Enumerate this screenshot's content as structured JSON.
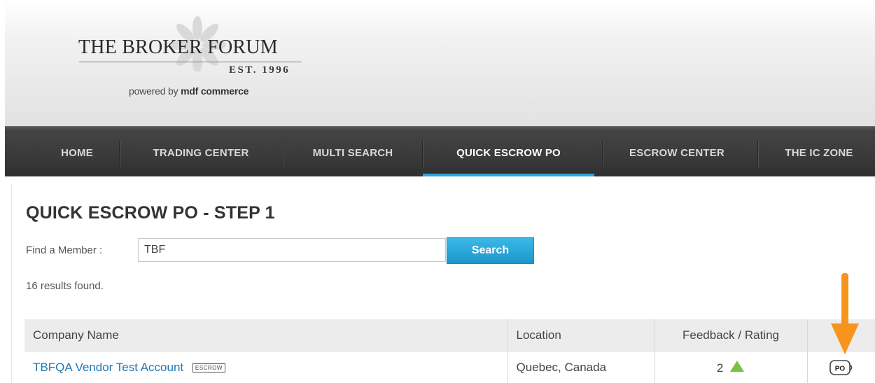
{
  "logo": {
    "title": "THE BROKER FORUM",
    "est": "EST. 1996",
    "powered_prefix": "powered by ",
    "powered_brand": "mdf commerce"
  },
  "nav": {
    "items": [
      {
        "label": "HOME",
        "active": false
      },
      {
        "label": "TRADING CENTER",
        "active": false
      },
      {
        "label": "MULTI SEARCH",
        "active": false
      },
      {
        "label": "QUICK ESCROW PO",
        "active": true
      },
      {
        "label": "ESCROW CENTER",
        "active": false
      },
      {
        "label": "THE IC ZONE",
        "active": false
      }
    ],
    "accent_color": "#2aa6d8"
  },
  "page": {
    "title": "QUICK ESCROW PO - STEP 1",
    "find_label": "Find a Member :",
    "search_value": "TBF",
    "search_button": "Search",
    "results_text": "16 results found."
  },
  "table": {
    "headers": [
      "Company Name",
      "Location",
      "Feedback / Rating",
      ""
    ],
    "rows": [
      {
        "company": "TBFQA Vendor Test Account",
        "badge": "ESCROW",
        "location": "Quebec, Canada",
        "rating": "2",
        "rating_icon": "green-triangle-up-icon",
        "action_icon": "po-icon"
      }
    ]
  },
  "annotation": {
    "icon": "arrow-down-icon",
    "color": "#f7941d"
  }
}
